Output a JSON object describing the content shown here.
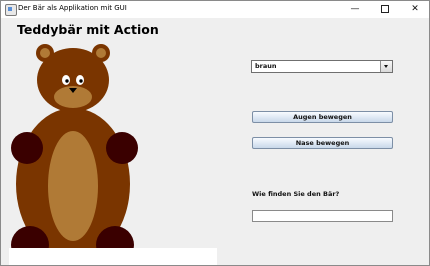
{
  "window": {
    "title": "Der Bär als Applikation mit GUI",
    "controls": {
      "minimize": "—",
      "maximize": "□",
      "close": "✕"
    }
  },
  "content": {
    "heading": "Teddybär mit Action",
    "combo": {
      "selected": "braun"
    },
    "buttons": {
      "eyes": "Augen bewegen",
      "nose": "Nase bewegen"
    },
    "question_label": "Wie finden Sie den Bär?",
    "answer_value": ""
  },
  "colors": {
    "bear_brown": "#7a3500",
    "bear_muzzle": "#b07a36",
    "paws": "#3a0000",
    "button_blue": "#c9d8ea"
  }
}
